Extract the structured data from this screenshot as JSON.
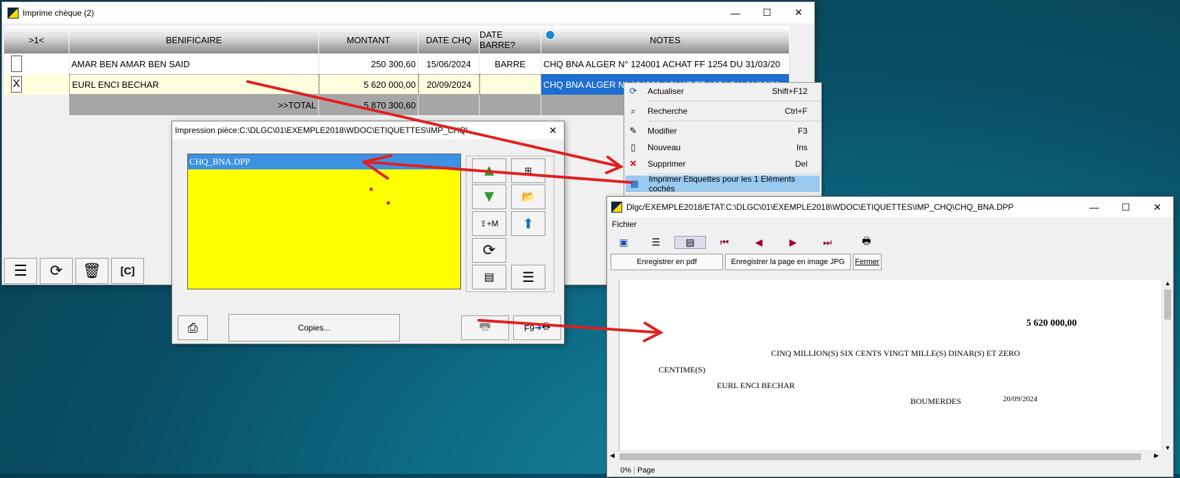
{
  "main_window": {
    "title": "Imprime chèque (2)",
    "controls": {
      "minimize": "—",
      "maximize": "☐",
      "close": "✕"
    },
    "columns": [
      ">1<",
      "BENIFICAIRE",
      "MONTANT",
      "DATE CHQ",
      "DATE BARRE?",
      "NOTES"
    ],
    "rows": [
      {
        "check": "",
        "beneficiaire": "AMAR BEN AMAR BEN SAID",
        "montant": "250 300,60",
        "date_chq": "15/06/2024",
        "date_barre": "BARRE",
        "notes": "CHQ BNA ALGER N° 124001   ACHAT  FF 1254 DU 31/03/20"
      },
      {
        "check": "X",
        "beneficiaire": "EURL ENCI  BECHAR",
        "montant": "5 620 000,00",
        "date_chq": "20/09/2024",
        "date_barre": "",
        "notes": "CHQ BNA ALGER N° 124002   ACHAT  FF 1254 DU 31/03/20"
      }
    ],
    "total_label": ">>TOTAL",
    "total_value": "5 870 300,60"
  },
  "context_menu": {
    "items": [
      {
        "label": "Actualiser",
        "shortcut": "Shift+F12",
        "icon": "refresh-icon"
      },
      {
        "label": "Recherche",
        "shortcut": "Ctrl+F",
        "icon": "binoculars-icon"
      },
      {
        "label": "Modifier",
        "shortcut": "F3",
        "icon": "edit-icon"
      },
      {
        "label": "Nouveau",
        "shortcut": "Ins",
        "icon": "new-doc-icon"
      },
      {
        "label": "Supprimer",
        "shortcut": "Del",
        "icon": "delete-x-icon"
      },
      {
        "label": "Imprimer Etiquettes pour les 1 Eléments cochés",
        "shortcut": "",
        "icon": "grid-icon"
      }
    ]
  },
  "print_dialog": {
    "title": "Impression pièce:C:\\DLGC\\01\\EXEMPLE2018\\WDOC\\ETIQUETTES\\IMP_CHQ\\",
    "selected_file": "CHQ_BNA.DPP",
    "copies_label": "Copies...",
    "print_key_label": "F9",
    "close": "✕"
  },
  "preview_window": {
    "title": "Dlgc/EXEMPLE2018/ETAT:C:\\DLGC\\01\\EXEMPLE2018\\WDOC\\ETIQUETTES\\IMP_CHQ\\CHQ_BNA.DPP",
    "menu": "Fichier",
    "btn_pdf": "Enregistrer en pdf",
    "btn_jpg": "Enregistrer la page en image JPG",
    "btn_close": "Fermer",
    "cheque": {
      "amount": "5 620 000,00",
      "words_line1": "CINQ MILLION(S) SIX CENTS VINGT MILLE(S)  DINAR(S) ET ZERO",
      "words_line2": "CENTIME(S)",
      "beneficiary": "EURL ENCI  BECHAR",
      "place": "BOUMERDES",
      "date": "20/09/2024"
    },
    "status_zoom": "0%",
    "status_page": "Page"
  },
  "colors": {
    "highlight": "#3d92e4",
    "list_bg": "#ffff00",
    "arrow": "#e02020",
    "menu_select": "#99c9ef"
  }
}
